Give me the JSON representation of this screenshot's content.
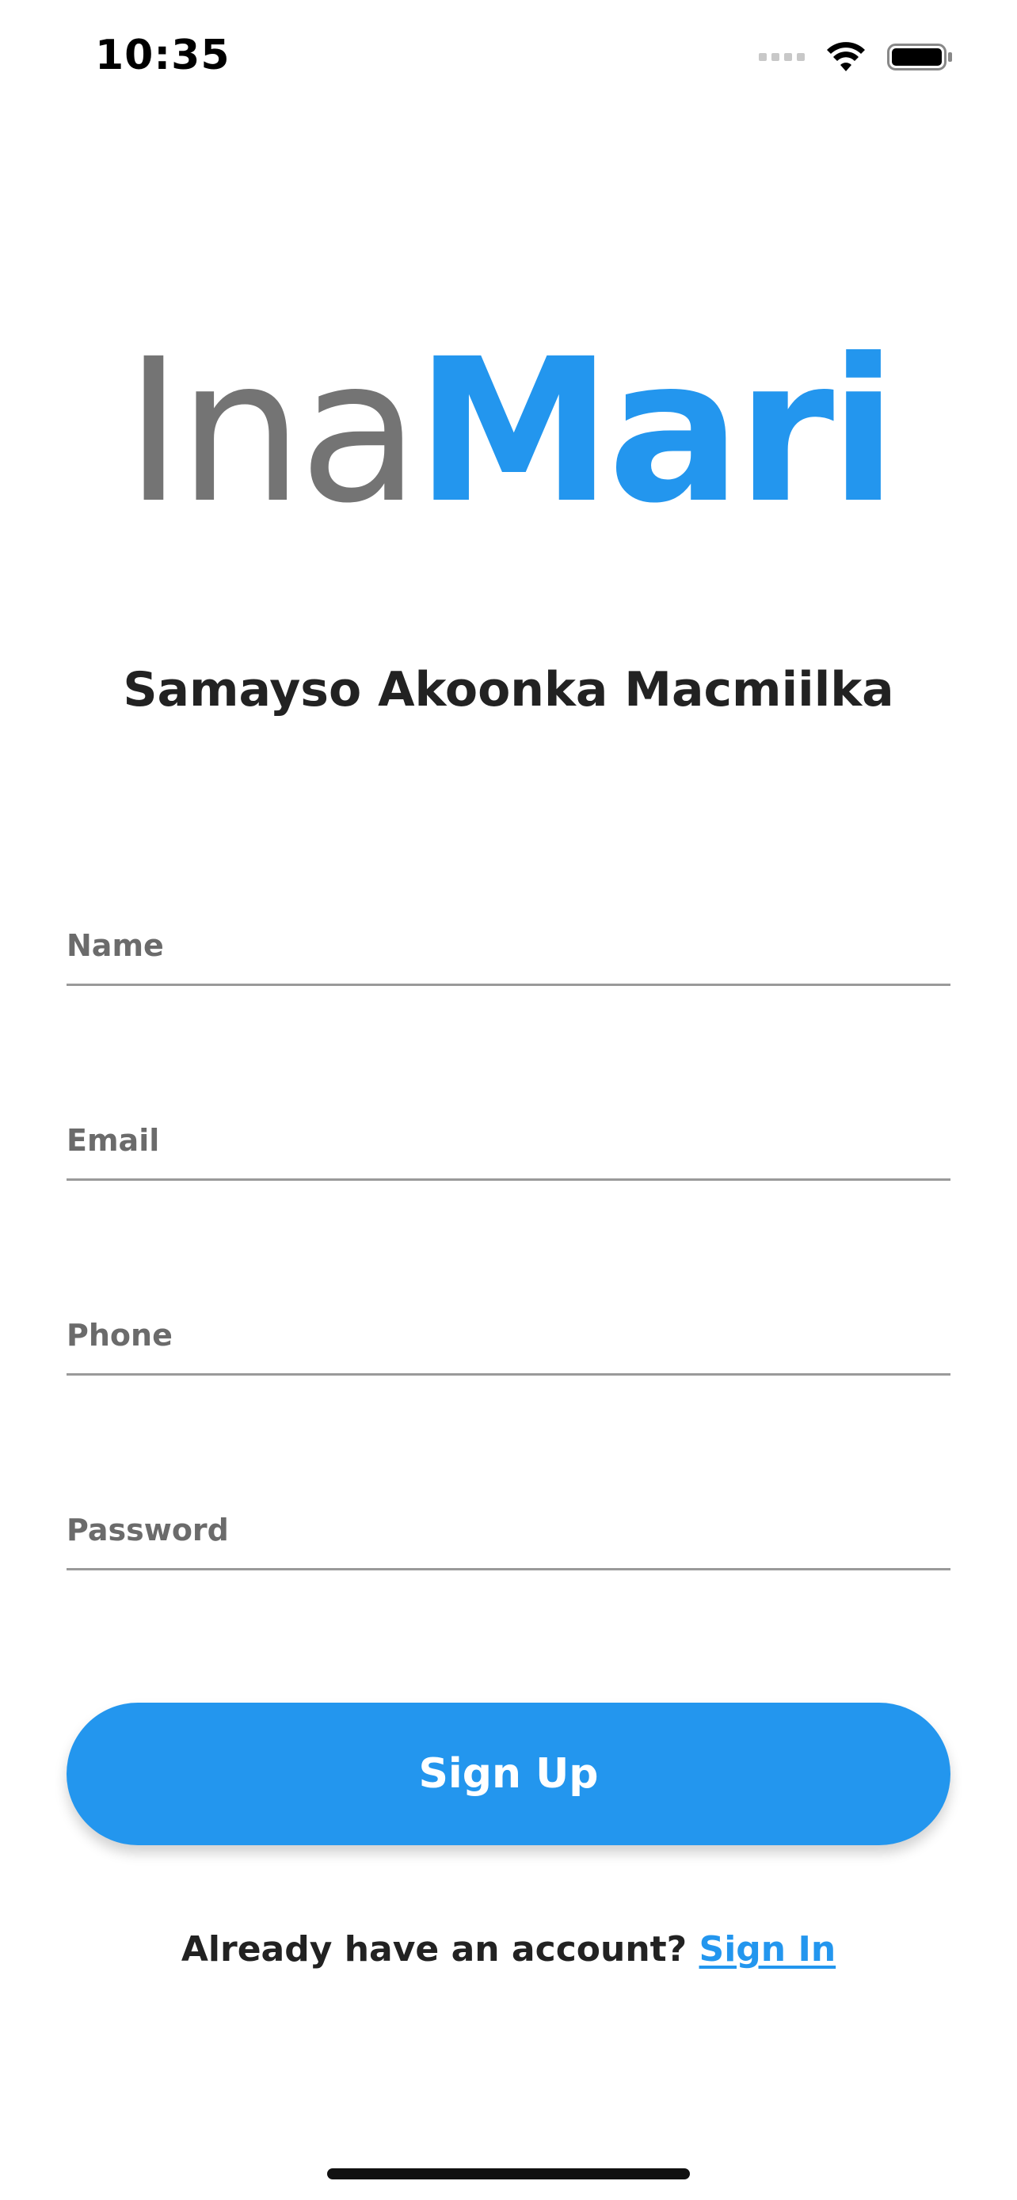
{
  "status_bar": {
    "time": "10:35",
    "signal_icon": "cellular-signal-icon",
    "wifi_icon": "wifi-icon",
    "battery_icon": "battery-icon"
  },
  "logo": {
    "part1": "Ina",
    "part2": "Mari",
    "color_part1": "#747474",
    "color_part2": "#2396ee"
  },
  "heading": "Samayso Akoonka Macmiilka",
  "form": {
    "fields": [
      {
        "label": "Name",
        "value": ""
      },
      {
        "label": "Email",
        "value": ""
      },
      {
        "label": "Phone",
        "value": ""
      },
      {
        "label": "Password",
        "value": ""
      }
    ],
    "submit_label": "Sign Up"
  },
  "footer": {
    "prompt": "Already have an account?",
    "link_label": "Sign In"
  },
  "colors": {
    "accent": "#2396ee",
    "label": "#6b6b6b"
  }
}
